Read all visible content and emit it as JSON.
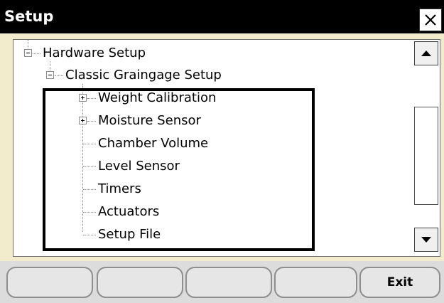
{
  "window": {
    "title": "Setup",
    "close_icon": "close-icon"
  },
  "tree": {
    "items": [
      {
        "label": "Hardware Setup",
        "expander": "minus"
      },
      {
        "label": "Classic Graingage Setup",
        "expander": "minus"
      },
      {
        "label": "Weight Calibration",
        "expander": "plus"
      },
      {
        "label": "Moisture Sensor",
        "expander": "plus"
      },
      {
        "label": "Chamber Volume",
        "expander": "none"
      },
      {
        "label": "Level Sensor",
        "expander": "none"
      },
      {
        "label": "Timers",
        "expander": "none"
      },
      {
        "label": "Actuators",
        "expander": "none"
      },
      {
        "label": "Setup File",
        "expander": "none"
      }
    ]
  },
  "scrollbar": {
    "up_icon": "arrow-up-icon",
    "down_icon": "arrow-down-icon"
  },
  "buttons": {
    "btn1": "",
    "btn2": "",
    "btn3": "",
    "btn4": "",
    "exit": "Exit"
  },
  "colors": {
    "titlebar": "#000000",
    "panel_border": "#f2eccc",
    "highlight": "#000000"
  }
}
